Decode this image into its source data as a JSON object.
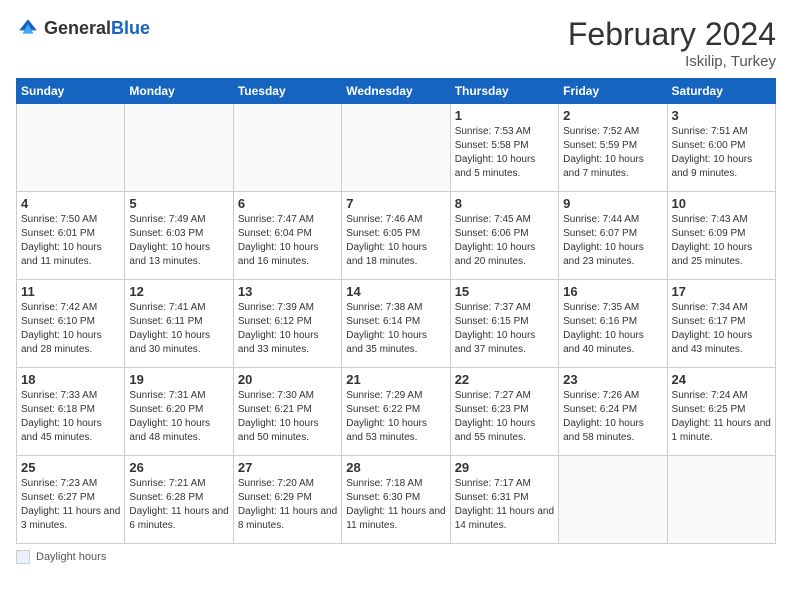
{
  "header": {
    "logo_general": "General",
    "logo_blue": "Blue",
    "title": "February 2024",
    "location": "Iskilip, Turkey"
  },
  "days_of_week": [
    "Sunday",
    "Monday",
    "Tuesday",
    "Wednesday",
    "Thursday",
    "Friday",
    "Saturday"
  ],
  "footer": {
    "label": "Daylight hours"
  },
  "weeks": [
    [
      {
        "day": "",
        "info": ""
      },
      {
        "day": "",
        "info": ""
      },
      {
        "day": "",
        "info": ""
      },
      {
        "day": "",
        "info": ""
      },
      {
        "day": "1",
        "info": "Sunrise: 7:53 AM\nSunset: 5:58 PM\nDaylight: 10 hours and 5 minutes."
      },
      {
        "day": "2",
        "info": "Sunrise: 7:52 AM\nSunset: 5:59 PM\nDaylight: 10 hours and 7 minutes."
      },
      {
        "day": "3",
        "info": "Sunrise: 7:51 AM\nSunset: 6:00 PM\nDaylight: 10 hours and 9 minutes."
      }
    ],
    [
      {
        "day": "4",
        "info": "Sunrise: 7:50 AM\nSunset: 6:01 PM\nDaylight: 10 hours and 11 minutes."
      },
      {
        "day": "5",
        "info": "Sunrise: 7:49 AM\nSunset: 6:03 PM\nDaylight: 10 hours and 13 minutes."
      },
      {
        "day": "6",
        "info": "Sunrise: 7:47 AM\nSunset: 6:04 PM\nDaylight: 10 hours and 16 minutes."
      },
      {
        "day": "7",
        "info": "Sunrise: 7:46 AM\nSunset: 6:05 PM\nDaylight: 10 hours and 18 minutes."
      },
      {
        "day": "8",
        "info": "Sunrise: 7:45 AM\nSunset: 6:06 PM\nDaylight: 10 hours and 20 minutes."
      },
      {
        "day": "9",
        "info": "Sunrise: 7:44 AM\nSunset: 6:07 PM\nDaylight: 10 hours and 23 minutes."
      },
      {
        "day": "10",
        "info": "Sunrise: 7:43 AM\nSunset: 6:09 PM\nDaylight: 10 hours and 25 minutes."
      }
    ],
    [
      {
        "day": "11",
        "info": "Sunrise: 7:42 AM\nSunset: 6:10 PM\nDaylight: 10 hours and 28 minutes."
      },
      {
        "day": "12",
        "info": "Sunrise: 7:41 AM\nSunset: 6:11 PM\nDaylight: 10 hours and 30 minutes."
      },
      {
        "day": "13",
        "info": "Sunrise: 7:39 AM\nSunset: 6:12 PM\nDaylight: 10 hours and 33 minutes."
      },
      {
        "day": "14",
        "info": "Sunrise: 7:38 AM\nSunset: 6:14 PM\nDaylight: 10 hours and 35 minutes."
      },
      {
        "day": "15",
        "info": "Sunrise: 7:37 AM\nSunset: 6:15 PM\nDaylight: 10 hours and 37 minutes."
      },
      {
        "day": "16",
        "info": "Sunrise: 7:35 AM\nSunset: 6:16 PM\nDaylight: 10 hours and 40 minutes."
      },
      {
        "day": "17",
        "info": "Sunrise: 7:34 AM\nSunset: 6:17 PM\nDaylight: 10 hours and 43 minutes."
      }
    ],
    [
      {
        "day": "18",
        "info": "Sunrise: 7:33 AM\nSunset: 6:18 PM\nDaylight: 10 hours and 45 minutes."
      },
      {
        "day": "19",
        "info": "Sunrise: 7:31 AM\nSunset: 6:20 PM\nDaylight: 10 hours and 48 minutes."
      },
      {
        "day": "20",
        "info": "Sunrise: 7:30 AM\nSunset: 6:21 PM\nDaylight: 10 hours and 50 minutes."
      },
      {
        "day": "21",
        "info": "Sunrise: 7:29 AM\nSunset: 6:22 PM\nDaylight: 10 hours and 53 minutes."
      },
      {
        "day": "22",
        "info": "Sunrise: 7:27 AM\nSunset: 6:23 PM\nDaylight: 10 hours and 55 minutes."
      },
      {
        "day": "23",
        "info": "Sunrise: 7:26 AM\nSunset: 6:24 PM\nDaylight: 10 hours and 58 minutes."
      },
      {
        "day": "24",
        "info": "Sunrise: 7:24 AM\nSunset: 6:25 PM\nDaylight: 11 hours and 1 minute."
      }
    ],
    [
      {
        "day": "25",
        "info": "Sunrise: 7:23 AM\nSunset: 6:27 PM\nDaylight: 11 hours and 3 minutes."
      },
      {
        "day": "26",
        "info": "Sunrise: 7:21 AM\nSunset: 6:28 PM\nDaylight: 11 hours and 6 minutes."
      },
      {
        "day": "27",
        "info": "Sunrise: 7:20 AM\nSunset: 6:29 PM\nDaylight: 11 hours and 8 minutes."
      },
      {
        "day": "28",
        "info": "Sunrise: 7:18 AM\nSunset: 6:30 PM\nDaylight: 11 hours and 11 minutes."
      },
      {
        "day": "29",
        "info": "Sunrise: 7:17 AM\nSunset: 6:31 PM\nDaylight: 11 hours and 14 minutes."
      },
      {
        "day": "",
        "info": ""
      },
      {
        "day": "",
        "info": ""
      }
    ]
  ]
}
